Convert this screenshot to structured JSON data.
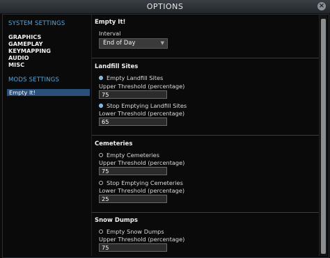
{
  "window": {
    "title": "OPTIONS",
    "close_glyph": "×"
  },
  "sidebar": {
    "system_heading": "SYSTEM SETTINGS",
    "system_items": [
      "GRAPHICS",
      "GAMEPLAY",
      "KEYMAPPING",
      "AUDIO",
      "MISC"
    ],
    "mods_heading": "MODS SETTINGS",
    "selected_item": "Empty It!",
    "accent_color": "#57a8de",
    "selected_bg": "#2a4f78"
  },
  "content": {
    "title": "Empty It!",
    "interval": {
      "label": "Interval",
      "value": "End of Day",
      "caret": "▼"
    },
    "landfill": {
      "title": "Landfill Sites",
      "empty_label": "Empty Landfill Sites",
      "empty_checked": true,
      "upper_label": "Upper Threshold (percentage)",
      "upper_value": "75",
      "stop_label": "Stop Emptying Landfill Sites",
      "stop_checked": true,
      "lower_label": "Lower Threshold (percentage)",
      "lower_value": "65"
    },
    "cemeteries": {
      "title": "Cemeteries",
      "empty_label": "Empty Cemeteries",
      "empty_checked": false,
      "upper_label": "Upper Threshold (percentage)",
      "upper_value": "75",
      "stop_label": "Stop Emptying Cemeteries",
      "stop_checked": false,
      "lower_label": "Lower Threshold (percentage)",
      "lower_value": "25"
    },
    "snow": {
      "title": "Snow Dumps",
      "empty_label": "Empty Snow Dumps",
      "empty_checked": false,
      "upper_label": "Upper Threshold (percentage)",
      "upper_value": "75"
    }
  }
}
